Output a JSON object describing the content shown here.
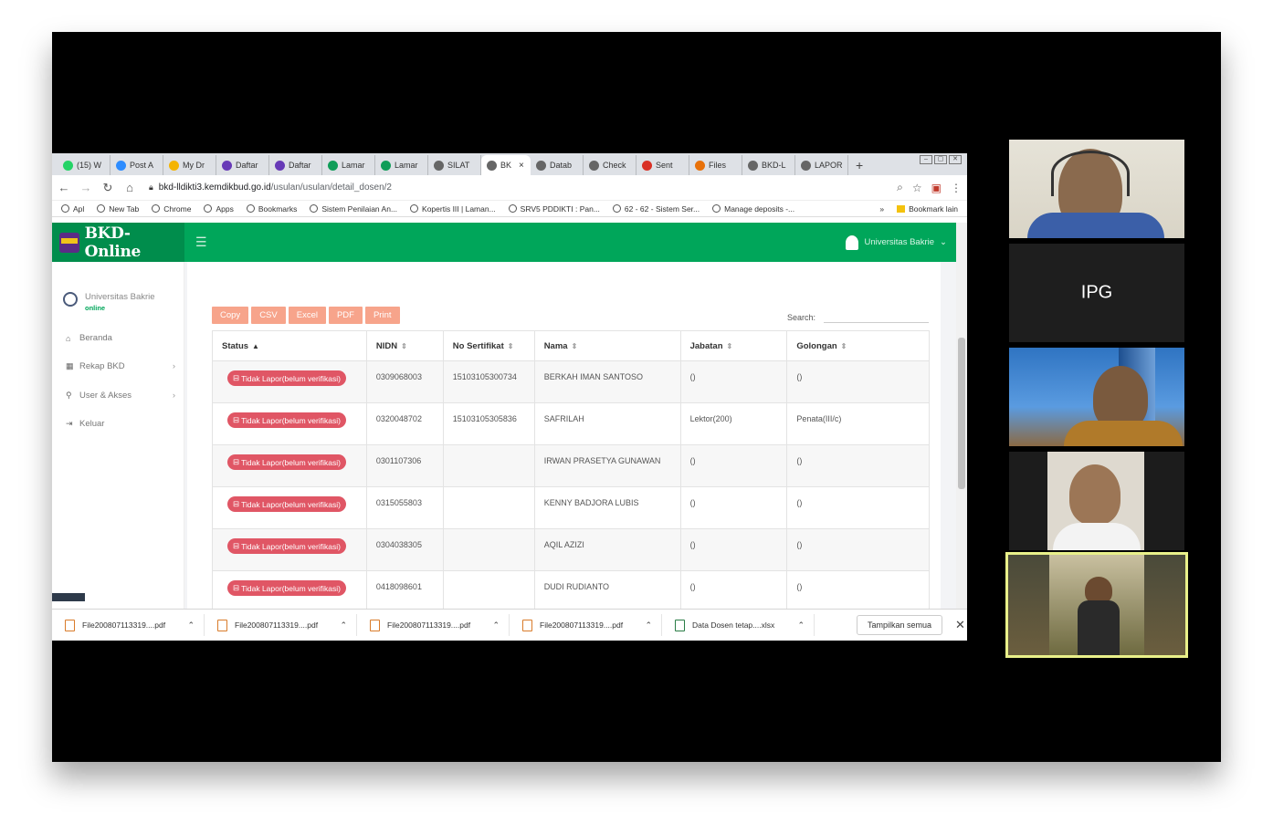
{
  "browser": {
    "tabs": [
      {
        "label": "(15) W",
        "color": "#25d366"
      },
      {
        "label": "Post A",
        "color": "#2d8cff"
      },
      {
        "label": "My Dr",
        "color": "#f4b400"
      },
      {
        "label": "Daftar",
        "color": "#673ab7"
      },
      {
        "label": "Daftar",
        "color": "#673ab7"
      },
      {
        "label": "Lamar",
        "color": "#0f9d58"
      },
      {
        "label": "Lamar",
        "color": "#0f9d58"
      },
      {
        "label": "SILAT",
        "color": "#666666"
      },
      {
        "label": "BK",
        "color": "#666666",
        "active": true
      },
      {
        "label": "Datab",
        "color": "#666666"
      },
      {
        "label": "Check",
        "color": "#666666"
      },
      {
        "label": "Sent",
        "color": "#d93025"
      },
      {
        "label": "Files",
        "color": "#e8710a"
      },
      {
        "label": "BKD-L",
        "color": "#666666"
      },
      {
        "label": "LAPOR",
        "color": "#666666"
      }
    ],
    "new_tab": "+",
    "url_host": "bkd-lldikti3.kemdikbud.go.id",
    "url_path": "/usulan/usulan/detail_dosen/2",
    "bookmarks": [
      "Apl",
      "New Tab",
      "Chrome",
      "Apps",
      "Bookmarks",
      "Sistem Penilaian An...",
      "Kopertis III | Laman...",
      "SRV5 PDDIKTI : Pan...",
      "62 - 62 - Sistem Ser...",
      "Manage deposits -..."
    ],
    "bookmarks_more": "»",
    "bookmarks_other": "Bookmark lain"
  },
  "site": {
    "logo_text": "BKD-Online",
    "user_name": "Universitas Bakrie",
    "sidebar": {
      "user_name": "Universitas Bakrie",
      "user_status": "online",
      "items": [
        {
          "label": "Beranda",
          "icon": "home-icon",
          "chevron": false
        },
        {
          "label": "Rekap BKD",
          "icon": "grid-icon",
          "chevron": true
        },
        {
          "label": "User & Akses",
          "icon": "users-icon",
          "chevron": true
        },
        {
          "label": "Keluar",
          "icon": "logout-icon",
          "chevron": false
        }
      ]
    },
    "export_buttons": [
      "Copy",
      "CSV",
      "Excel",
      "PDF",
      "Print"
    ],
    "search_label": "Search:",
    "table": {
      "headers": [
        "Status",
        "NIDN",
        "No Sertifikat",
        "Nama",
        "Jabatan",
        "Golongan"
      ],
      "rows": [
        {
          "status": "Tidak Lapor(belum verifikasi)",
          "nidn": "0309068003",
          "sertifikat": "15103105300734",
          "nama": "BERKAH IMAN SANTOSO",
          "jabatan": "()",
          "golongan": "()"
        },
        {
          "status": "Tidak Lapor(belum verifikasi)",
          "nidn": "0320048702",
          "sertifikat": "15103105305836",
          "nama": "SAFRILAH",
          "jabatan": "Lektor(200)",
          "golongan": "Penata(III/c)"
        },
        {
          "status": "Tidak Lapor(belum verifikasi)",
          "nidn": "0301107306",
          "sertifikat": "",
          "nama": "IRWAN PRASETYA GUNAWAN",
          "jabatan": "()",
          "golongan": "()"
        },
        {
          "status": "Tidak Lapor(belum verifikasi)",
          "nidn": "0315055803",
          "sertifikat": "",
          "nama": "KENNY BADJORA LUBIS",
          "jabatan": "()",
          "golongan": "()"
        },
        {
          "status": "Tidak Lapor(belum verifikasi)",
          "nidn": "0304038305",
          "sertifikat": "",
          "nama": "AQIL AZIZI",
          "jabatan": "()",
          "golongan": "()"
        },
        {
          "status": "Tidak Lapor(belum verifikasi)",
          "nidn": "0418098601",
          "sertifikat": "",
          "nama": "DUDI RUDIANTO",
          "jabatan": "()",
          "golongan": "()"
        }
      ]
    }
  },
  "downloads": {
    "files": [
      {
        "name": "File200807113319....pdf",
        "type": "pdf"
      },
      {
        "name": "File200807113319....pdf",
        "type": "pdf"
      },
      {
        "name": "File200807113319....pdf",
        "type": "pdf"
      },
      {
        "name": "File200807113319....pdf",
        "type": "pdf"
      },
      {
        "name": "Data Dosen tetap....xlsx",
        "type": "xlsx"
      }
    ],
    "show_all": "Tampilkan semua"
  },
  "video": {
    "tile2_label": "IPG",
    "active_border_color": "#e9f08a"
  }
}
